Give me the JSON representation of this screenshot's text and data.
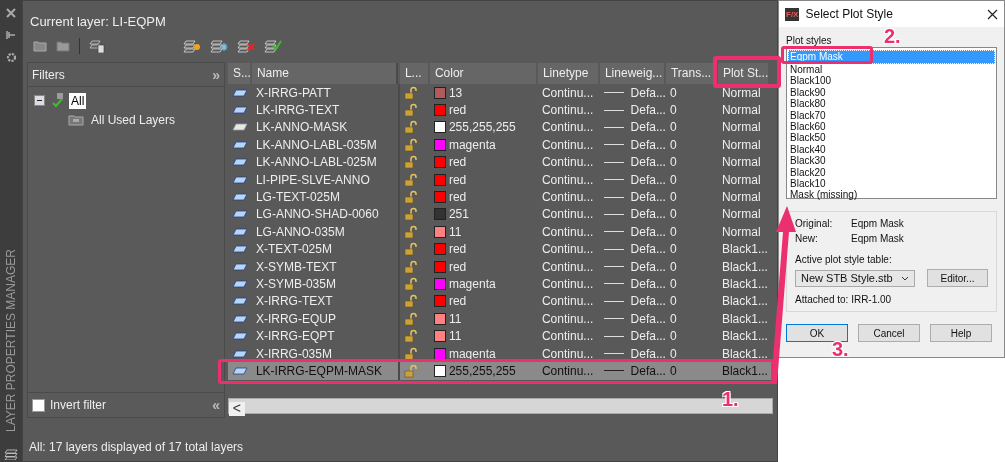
{
  "palette_title": "LAYER PROPERTIES MANAGER",
  "current_layer": "Current layer: LI-EQPM",
  "filters": {
    "title": "Filters",
    "expand_glyph": "»",
    "collapse_glyph": "«",
    "tree": [
      {
        "label": "All",
        "selected": true,
        "expanded": true,
        "children": [
          {
            "label": "All Used Layers",
            "selected": false
          }
        ]
      }
    ],
    "invert_filter": {
      "label": "Invert filter",
      "checked": false
    }
  },
  "table": {
    "scroll_left_glyph": "<",
    "columns": [
      "S...",
      "Name",
      "L...",
      "Color",
      "Linetype",
      "Lineweig...",
      "Trans...",
      "Plot St..."
    ],
    "rows": [
      {
        "name": "X-IRRG-PATT",
        "in_use": true,
        "color_name": "13",
        "color": "#b05a5a",
        "linetype": "Continu...",
        "lineweight": "Defa...",
        "transparency": "0",
        "plot_style": "Normal",
        "selected": false
      },
      {
        "name": "LK-IRRG-TEXT",
        "in_use": true,
        "color_name": "red",
        "color": "#ff0000",
        "linetype": "Continu...",
        "lineweight": "Defa...",
        "transparency": "0",
        "plot_style": "Normal",
        "selected": false
      },
      {
        "name": "LK-ANNO-MASK",
        "in_use": false,
        "color_name": "255,255,255",
        "color": "#ffffff",
        "linetype": "Continu...",
        "lineweight": "Defa...",
        "transparency": "0",
        "plot_style": "Normal",
        "selected": false
      },
      {
        "name": "LK-ANNO-LABL-035M",
        "in_use": true,
        "color_name": "magenta",
        "color": "#ff00ff",
        "linetype": "Continu...",
        "lineweight": "Defa...",
        "transparency": "0",
        "plot_style": "Normal",
        "selected": false
      },
      {
        "name": "LK-ANNO-LABL-025M",
        "in_use": true,
        "color_name": "red",
        "color": "#ff0000",
        "linetype": "Continu...",
        "lineweight": "Defa...",
        "transparency": "0",
        "plot_style": "Normal",
        "selected": false
      },
      {
        "name": "LI-PIPE-SLVE-ANNO",
        "in_use": true,
        "color_name": "red",
        "color": "#ff0000",
        "linetype": "Continu...",
        "lineweight": "Defa...",
        "transparency": "0",
        "plot_style": "Normal",
        "selected": false
      },
      {
        "name": "LG-TEXT-025M",
        "in_use": true,
        "color_name": "red",
        "color": "#ff0000",
        "linetype": "Continu...",
        "lineweight": "Defa...",
        "transparency": "0",
        "plot_style": "Normal",
        "selected": false
      },
      {
        "name": "LG-ANNO-SHAD-0060",
        "in_use": true,
        "color_name": "251",
        "color": "#333333",
        "linetype": "Continu...",
        "lineweight": "Defa...",
        "transparency": "0",
        "plot_style": "Normal",
        "selected": false
      },
      {
        "name": "LG-ANNO-035M",
        "in_use": true,
        "color_name": "11",
        "color": "#ff8080",
        "linetype": "Continu...",
        "lineweight": "Defa...",
        "transparency": "0",
        "plot_style": "Normal",
        "selected": false
      },
      {
        "name": "X-TEXT-025M",
        "in_use": true,
        "color_name": "red",
        "color": "#ff0000",
        "linetype": "Continu...",
        "lineweight": "Defa...",
        "transparency": "0",
        "plot_style": "Black1...",
        "selected": false
      },
      {
        "name": "X-SYMB-TEXT",
        "in_use": true,
        "color_name": "red",
        "color": "#ff0000",
        "linetype": "Continu...",
        "lineweight": "Defa...",
        "transparency": "0",
        "plot_style": "Black1...",
        "selected": false
      },
      {
        "name": "X-SYMB-035M",
        "in_use": true,
        "color_name": "magenta",
        "color": "#ff00ff",
        "linetype": "Continu...",
        "lineweight": "Defa...",
        "transparency": "0",
        "plot_style": "Black1...",
        "selected": false
      },
      {
        "name": "X-IRRG-TEXT",
        "in_use": true,
        "color_name": "red",
        "color": "#ff0000",
        "linetype": "Continu...",
        "lineweight": "Defa...",
        "transparency": "0",
        "plot_style": "Black1...",
        "selected": false
      },
      {
        "name": "X-IRRG-EQUP",
        "in_use": true,
        "color_name": "11",
        "color": "#ff8080",
        "linetype": "Continu...",
        "lineweight": "Defa...",
        "transparency": "0",
        "plot_style": "Black1...",
        "selected": false
      },
      {
        "name": "X-IRRG-EQPT",
        "in_use": true,
        "color_name": "11",
        "color": "#ff8080",
        "linetype": "Continu...",
        "lineweight": "Defa...",
        "transparency": "0",
        "plot_style": "Black1...",
        "selected": false
      },
      {
        "name": "X-IRRG-035M",
        "in_use": true,
        "color_name": "magenta",
        "color": "#ff00ff",
        "linetype": "Continu...",
        "lineweight": "Defa...",
        "transparency": "0",
        "plot_style": "Black1...",
        "selected": false
      },
      {
        "name": "LK-IRRG-EQPM-MASK",
        "in_use": true,
        "color_name": "255,255,255",
        "color": "#ffffff",
        "linetype": "Continu...",
        "lineweight": "Defa...",
        "transparency": "0",
        "plot_style": "Black1...",
        "selected": true
      }
    ]
  },
  "status_bar": "All: 17 layers displayed of 17 total layers",
  "dialog": {
    "title": "Select Plot Style",
    "app_icon": "F/X",
    "list_label": "Plot styles",
    "plot_styles": [
      {
        "label": "Eqpm Mask",
        "selected": true
      },
      {
        "label": "Normal",
        "selected": false
      },
      {
        "label": "Black100",
        "selected": false
      },
      {
        "label": "Black90",
        "selected": false
      },
      {
        "label": "Black80",
        "selected": false
      },
      {
        "label": "Black70",
        "selected": false
      },
      {
        "label": "Black60",
        "selected": false
      },
      {
        "label": "Black50",
        "selected": false
      },
      {
        "label": "Black40",
        "selected": false
      },
      {
        "label": "Black30",
        "selected": false
      },
      {
        "label": "Black20",
        "selected": false
      },
      {
        "label": "Black10",
        "selected": false
      },
      {
        "label": "Mask (missing)",
        "selected": false
      }
    ],
    "original_label": "Original:",
    "original_value": "Eqpm Mask",
    "new_label": "New:",
    "new_value": "Eqpm Mask",
    "table_label": "Active plot style table:",
    "table_value": "New STB Style.stb",
    "editor_button": "Editor...",
    "attached": "Attached to: IRR-1.00",
    "buttons": [
      "OK",
      "Cancel",
      "Help"
    ]
  },
  "annotations": [
    "1.",
    "2.",
    "3."
  ]
}
